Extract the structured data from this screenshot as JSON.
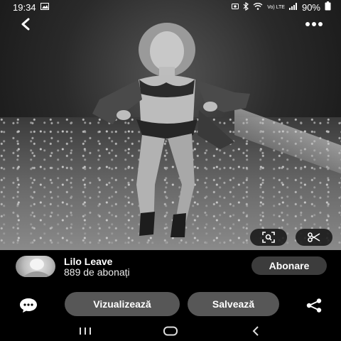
{
  "status_bar": {
    "time": "19:34",
    "network": "Vo) LTE",
    "battery": "90%",
    "icons": [
      "gallery-notification-icon",
      "screenshot-icon",
      "bluetooth-icon",
      "wifi-icon",
      "signal-icon",
      "battery-icon"
    ]
  },
  "top_bar": {
    "back_icon": "chevron-left-icon",
    "more_icon": "more-horizontal-icon"
  },
  "photo": {
    "tools": [
      "visual-search-icon",
      "cut-scissors-icon"
    ]
  },
  "creator": {
    "name": "Lilo Leave",
    "followers": "889 de abonați",
    "follow_label": "Abonare"
  },
  "actions": {
    "comment_icon": "comment-bubble-icon",
    "view_label": "Vizualizează",
    "save_label": "Salvează",
    "share_icon": "share-icon"
  },
  "nav": {
    "items": [
      "recents-icon",
      "home-icon",
      "back-icon"
    ]
  },
  "colors": {
    "background": "#000000",
    "button": "#575757",
    "follow_button": "#3c3c3c",
    "text": "#ffffff"
  }
}
